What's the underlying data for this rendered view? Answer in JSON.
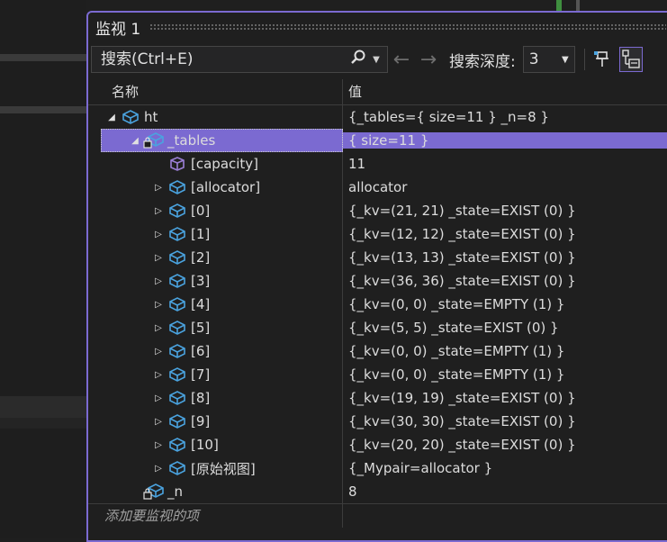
{
  "window": {
    "title": "监视 1"
  },
  "toolbar": {
    "search_placeholder": "搜索(Ctrl+E)",
    "depth_label": "搜索深度:",
    "depth_value": "3"
  },
  "columns": {
    "name": "名称",
    "value": "值"
  },
  "rows": [
    {
      "name": "ht",
      "value": "{_tables={ size=11 } _n=8 }"
    },
    {
      "name": "_tables",
      "value": "{ size=11 }"
    },
    {
      "name": "[capacity]",
      "value": "11"
    },
    {
      "name": "[allocator]",
      "value": "allocator"
    },
    {
      "name": "[0]",
      "value": "{_kv=(21, 21) _state=EXIST (0) }"
    },
    {
      "name": "[1]",
      "value": "{_kv=(12, 12) _state=EXIST (0) }"
    },
    {
      "name": "[2]",
      "value": "{_kv=(13, 13) _state=EXIST (0) }"
    },
    {
      "name": "[3]",
      "value": "{_kv=(36, 36) _state=EXIST (0) }"
    },
    {
      "name": "[4]",
      "value": "{_kv=(0, 0) _state=EMPTY (1) }"
    },
    {
      "name": "[5]",
      "value": "{_kv=(5, 5) _state=EXIST (0) }"
    },
    {
      "name": "[6]",
      "value": "{_kv=(0, 0) _state=EMPTY (1) }"
    },
    {
      "name": "[7]",
      "value": "{_kv=(0, 0) _state=EMPTY (1) }"
    },
    {
      "name": "[8]",
      "value": "{_kv=(19, 19) _state=EXIST (0) }"
    },
    {
      "name": "[9]",
      "value": "{_kv=(30, 30) _state=EXIST (0) }"
    },
    {
      "name": "[10]",
      "value": "{_kv=(20, 20) _state=EXIST (0) }"
    },
    {
      "name": "[原始视图]",
      "value": "{_Mypair=allocator }"
    },
    {
      "name": "_n",
      "value": "8"
    }
  ],
  "add_watch": "添加要监视的项",
  "colors": {
    "accent": "#7b6ad1",
    "object_icon": "#4aa3df",
    "capacity_icon": "#9b7fd6"
  }
}
